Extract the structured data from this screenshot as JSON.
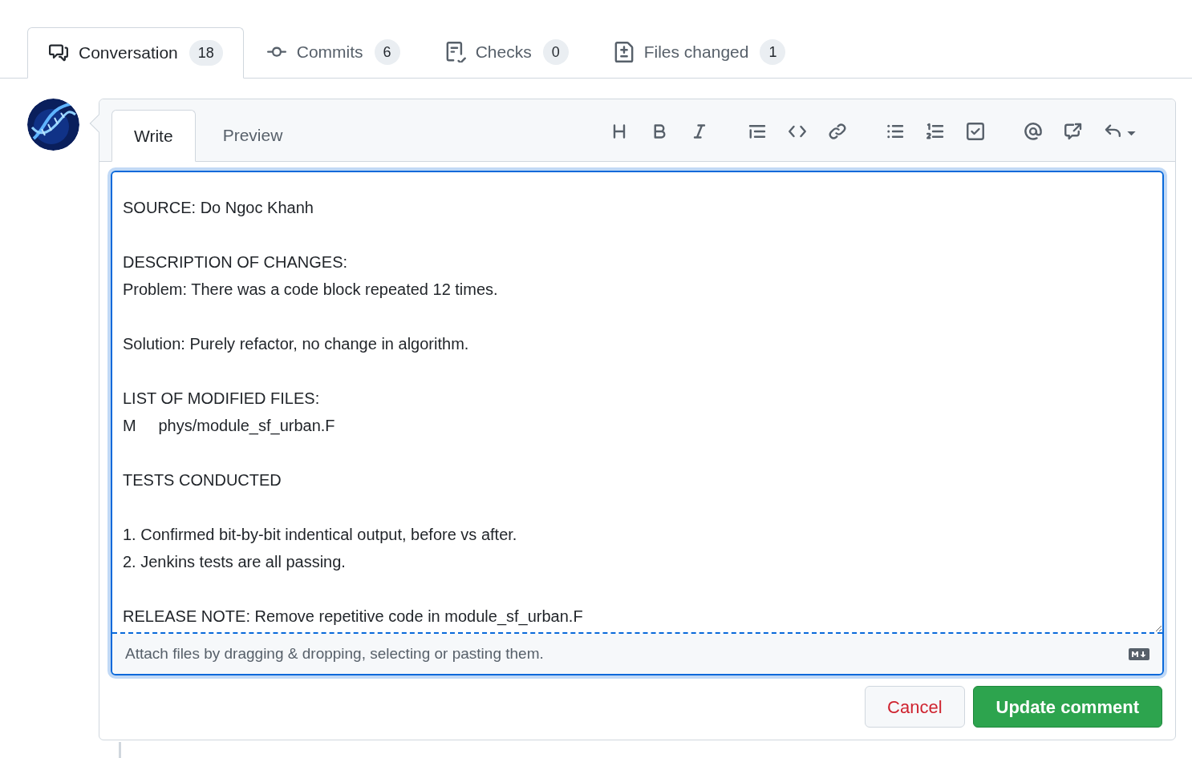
{
  "tabs": [
    {
      "kind": "conversation",
      "label": "Conversation",
      "count": "18",
      "selected": true
    },
    {
      "kind": "commits",
      "label": "Commits",
      "count": "6",
      "selected": false
    },
    {
      "kind": "checks",
      "label": "Checks",
      "count": "0",
      "selected": false
    },
    {
      "kind": "files",
      "label": "Files changed",
      "count": "1",
      "selected": false
    }
  ],
  "editor": {
    "tabs": [
      {
        "label": "Write",
        "selected": true
      },
      {
        "label": "Preview",
        "selected": false
      }
    ],
    "toolbar_groups": [
      [
        {
          "kind": "heading"
        },
        {
          "kind": "bold"
        },
        {
          "kind": "italic"
        }
      ],
      [
        {
          "kind": "quote"
        },
        {
          "kind": "code"
        },
        {
          "kind": "link"
        }
      ],
      [
        {
          "kind": "bullet-list"
        },
        {
          "kind": "numbered-list"
        },
        {
          "kind": "task-list"
        }
      ],
      [
        {
          "kind": "mention"
        },
        {
          "kind": "reference"
        },
        {
          "kind": "reply"
        }
      ]
    ],
    "paragraphs": [
      [
        "SOURCE: Do Ngoc Khanh"
      ],
      [
        "DESCRIPTION OF CHANGES:",
        "Problem: There was a code block repeated 12 times."
      ],
      [
        "Solution: Purely refactor, no change in algorithm."
      ],
      [
        "LIST OF MODIFIED FILES:",
        "M\tphys/module_sf_urban.F"
      ],
      [
        "TESTS CONDUCTED"
      ],
      [
        "1. Confirmed bit-by-bit indentical output, before vs after.",
        "2. Jenkins tests are all passing."
      ],
      [
        "RELEASE NOTE: Remove repetitive code in module_sf_urban.F"
      ]
    ],
    "attach_hint": "Attach files by dragging & dropping, selecting or pasting them."
  },
  "buttons": [
    {
      "kind": "cancel",
      "label": "Cancel"
    },
    {
      "kind": "primary",
      "label": "Update comment"
    }
  ]
}
